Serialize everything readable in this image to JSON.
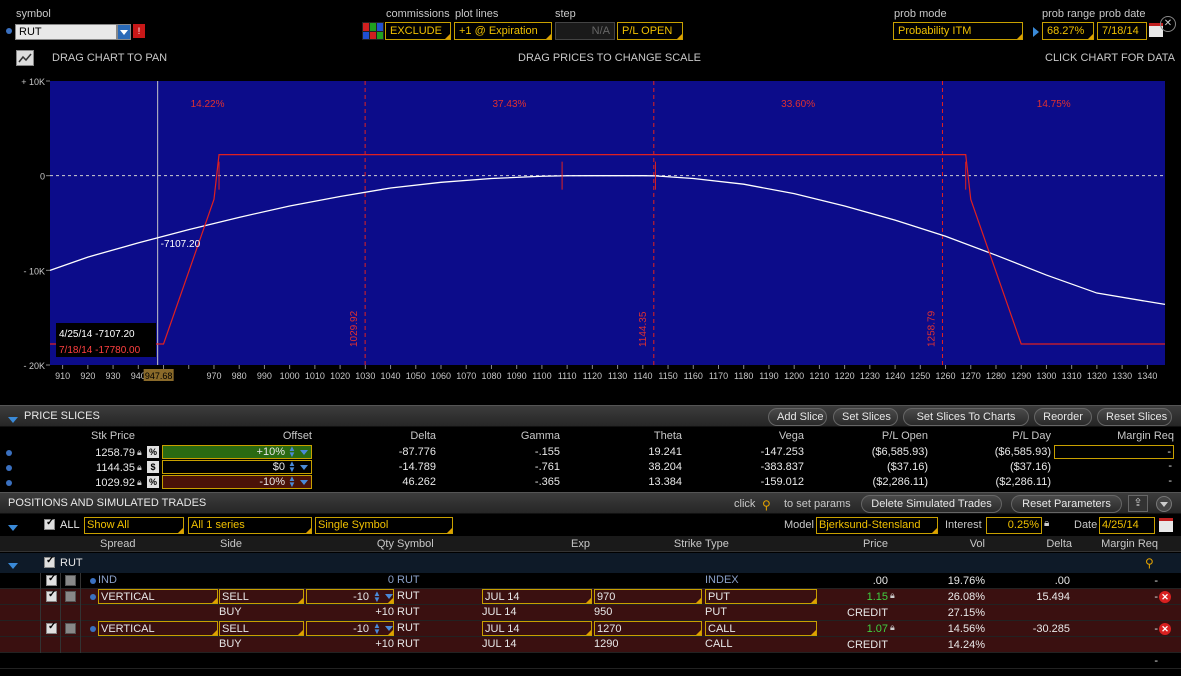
{
  "header": {
    "symbol_label": "symbol",
    "symbol_value": "RUT",
    "commissions_label": "commissions",
    "commissions_value": "EXCLUDE",
    "plot_lines_label": "plot lines",
    "plot_lines_value": "+1 @ Expiration",
    "step_label": "step",
    "step_value": "N/A",
    "pl_mode": "P/L OPEN",
    "prob_mode_label": "prob mode",
    "prob_mode_value": "Probability ITM",
    "prob_range_label": "prob range",
    "prob_range_value": "68.27%",
    "prob_date_label": "prob date",
    "prob_date_value": "7/18/14"
  },
  "chart_hints": {
    "left": "DRAG CHART TO PAN",
    "center": "DRAG PRICES TO CHANGE SCALE",
    "right": "CLICK CHART FOR DATA"
  },
  "chart_data": {
    "type": "line",
    "x_ticks": [
      910,
      920,
      930,
      940,
      950,
      960,
      970,
      980,
      990,
      1000,
      1010,
      1020,
      1030,
      1040,
      1050,
      1060,
      1070,
      1080,
      1090,
      1100,
      1110,
      1120,
      1130,
      1140,
      1150,
      1160,
      1170,
      1180,
      1190,
      1200,
      1210,
      1220,
      1230,
      1240,
      1250,
      1260,
      1270,
      1280,
      1290,
      1300,
      1310,
      1320,
      1330,
      1340
    ],
    "x_tick_labels_shown": [
      "910",
      "920",
      "930",
      "940",
      "947.68",
      "970",
      "980",
      "990",
      "1000",
      "1010",
      "1020",
      "1030",
      "1040",
      "1050",
      "1060",
      "1070",
      "1080",
      "1090",
      "1100",
      "1110",
      "1120",
      "1130",
      "1140",
      "1150",
      "1160",
      "1170",
      "1180",
      "1190",
      "1200",
      "1210",
      "1220",
      "1230",
      "1240",
      "1250",
      "1260",
      "1270",
      "1280",
      "1290",
      "1300",
      "1310",
      "1320",
      "1330",
      "1340"
    ],
    "x_hover_label": "947.68",
    "y_tick_labels": [
      "+ 10K",
      "0",
      "- 10K",
      "- 20K"
    ],
    "y_ticks": [
      10000,
      0,
      -10000,
      -20000
    ],
    "xlim": [
      905,
      1347
    ],
    "ylim": [
      -20000,
      10000
    ],
    "series": [
      {
        "name": "4/25/14",
        "color": "#ffffff",
        "x": [
          905,
          920,
          940,
          960,
          980,
          1000,
          1020,
          1040,
          1060,
          1080,
          1100,
          1110,
          1120,
          1130,
          1140,
          1145,
          1160,
          1180,
          1200,
          1220,
          1240,
          1260,
          1280,
          1300,
          1320,
          1347
        ],
        "y": [
          -10000,
          -8600,
          -7100,
          -5700,
          -4400,
          -3200,
          -2200,
          -1300,
          -700,
          -300,
          -60,
          -10,
          0,
          0,
          0,
          -20,
          -300,
          -900,
          -1900,
          -3200,
          -4700,
          -6400,
          -8400,
          -10500,
          -12400,
          -13600
        ]
      },
      {
        "name": "7/18/14",
        "color": "#e02020",
        "x": [
          905,
          950,
          970,
          972,
          1268,
          1270,
          1290,
          1347
        ],
        "y": [
          -17780,
          -17780,
          -2500,
          2220,
          2220,
          -2500,
          -17780,
          -17780
        ]
      }
    ],
    "prob_lines": [
      1029.92,
      1144.35,
      1258.79
    ],
    "prob_line_labels": [
      "1029.92",
      "1144.35",
      "1258.79"
    ],
    "prob_regions": [
      "14.22%",
      "37.43%",
      "33.60%",
      "14.75%"
    ],
    "crosshair_x": 947.68,
    "crosshair_label": "-7107.20",
    "tooltip": [
      {
        "date": "4/25/14",
        "value": "-7107.20",
        "color": "#ffffff"
      },
      {
        "date": "7/18/14",
        "value": "-17780.00",
        "color": "#ff4040"
      }
    ]
  },
  "price_slices": {
    "title": "PRICE SLICES",
    "buttons": [
      "Add Slice",
      "Set Slices",
      "Set Slices To Charts",
      "Reorder",
      "Reset Slices"
    ],
    "columns": [
      "Stk Price",
      "Offset",
      "Delta",
      "Gamma",
      "Theta",
      "Vega",
      "P/L Open",
      "P/L Day",
      "Margin Req"
    ],
    "rows": [
      {
        "stk": "1258.79",
        "unit": "%",
        "offset": "+10%",
        "delta": "-87.776",
        "gamma": "-.155",
        "theta": "19.241",
        "vega": "-147.253",
        "pl_open": "($6,585.93)",
        "pl_day": "($6,585.93)",
        "margin": "-",
        "offset_bg": "#2a6a12"
      },
      {
        "stk": "1144.35",
        "unit": "$",
        "offset": "$0",
        "delta": "-14.789",
        "gamma": "-.761",
        "theta": "38.204",
        "vega": "-383.837",
        "pl_open": "($37.16)",
        "pl_day": "($37.16)",
        "margin": "-",
        "offset_bg": "#000000"
      },
      {
        "stk": "1029.92",
        "unit": "%",
        "offset": "-10%",
        "delta": "46.262",
        "gamma": "-.365",
        "theta": "13.384",
        "vega": "-159.012",
        "pl_open": "($2,286.11)",
        "pl_day": "($2,286.11)",
        "margin": "-",
        "offset_bg": "#4a1208"
      }
    ]
  },
  "positions": {
    "title": "POSITIONS AND SIMULATED TRADES",
    "click_text": "click",
    "set_params_text": "to set params",
    "delete_btn": "Delete Simulated Trades",
    "reset_btn": "Reset Parameters",
    "all_label": "ALL",
    "filter_show": "Show All",
    "filter_series": "All 1 series",
    "filter_symbol": "Single Symbol",
    "model_label": "Model",
    "model_value": "Bjerksund-Stensland",
    "interest_label": "Interest",
    "interest_value": "0.25%",
    "date_label": "Date",
    "date_value": "4/25/14",
    "columns": [
      "Spread",
      "Side",
      "Qty",
      "Symbol",
      "Exp",
      "Strike",
      "Type",
      "Price",
      "Vol",
      "Delta",
      "Margin Req"
    ],
    "group": "RUT",
    "rows": [
      {
        "spread": "IND",
        "side": "",
        "qty": "0",
        "symbol": "RUT",
        "exp": "",
        "strike": "",
        "type": "INDEX",
        "price": ".00",
        "vol": "19.76%",
        "delta": ".00",
        "margin": "-",
        "style": "plain"
      },
      {
        "spread": "VERTICAL",
        "side": "SELL",
        "qty": "-10",
        "symbol": "RUT",
        "exp": "JUL 14",
        "strike": "970",
        "type": "PUT",
        "price": "1.15",
        "vol": "26.08%",
        "delta": "15.494",
        "margin": "-",
        "style": "lead"
      },
      {
        "spread": "",
        "side": "BUY",
        "qty": "+10",
        "symbol": "RUT",
        "exp": "JUL 14",
        "strike": "950",
        "type": "PUT",
        "price": "CREDIT",
        "vol": "27.15%",
        "delta": "",
        "margin": "",
        "style": "leg"
      },
      {
        "spread": "VERTICAL",
        "side": "SELL",
        "qty": "-10",
        "symbol": "RUT",
        "exp": "JUL 14",
        "strike": "1270",
        "type": "CALL",
        "price": "1.07",
        "vol": "14.56%",
        "delta": "-30.285",
        "margin": "-",
        "style": "lead"
      },
      {
        "spread": "",
        "side": "BUY",
        "qty": "+10",
        "symbol": "RUT",
        "exp": "JUL 14",
        "strike": "1290",
        "type": "CALL",
        "price": "CREDIT",
        "vol": "14.24%",
        "delta": "",
        "margin": "",
        "style": "leg"
      },
      {
        "spread": "",
        "side": "",
        "qty": "",
        "symbol": "",
        "exp": "",
        "strike": "",
        "type": "",
        "price": "",
        "vol": "",
        "delta": "",
        "margin": "-",
        "style": "empty"
      }
    ]
  }
}
